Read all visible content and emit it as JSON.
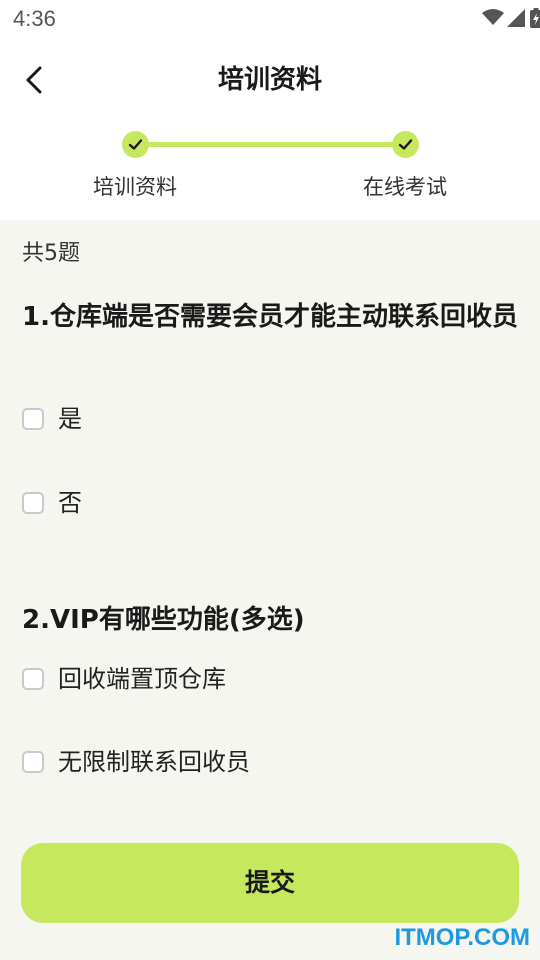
{
  "status_bar": {
    "time": "4:36"
  },
  "header": {
    "title": "培训资料"
  },
  "steps": [
    {
      "label": "培训资料",
      "done": true
    },
    {
      "label": "在线考试",
      "done": true
    }
  ],
  "quiz": {
    "count_text": "共5题",
    "questions": [
      {
        "title": "1.仓库端是否需要会员才能主动联系回收员",
        "options": [
          "是",
          "否"
        ]
      },
      {
        "title": "2.VIP有哪些功能(多选)",
        "options": [
          "回收端置顶仓库",
          "无限制联系回收员"
        ]
      }
    ]
  },
  "submit_label": "提交",
  "watermark": "ITMOP.COM",
  "colors": {
    "accent": "#c6e85e",
    "background": "#f6f6f1",
    "watermark": "#1e9be0"
  }
}
